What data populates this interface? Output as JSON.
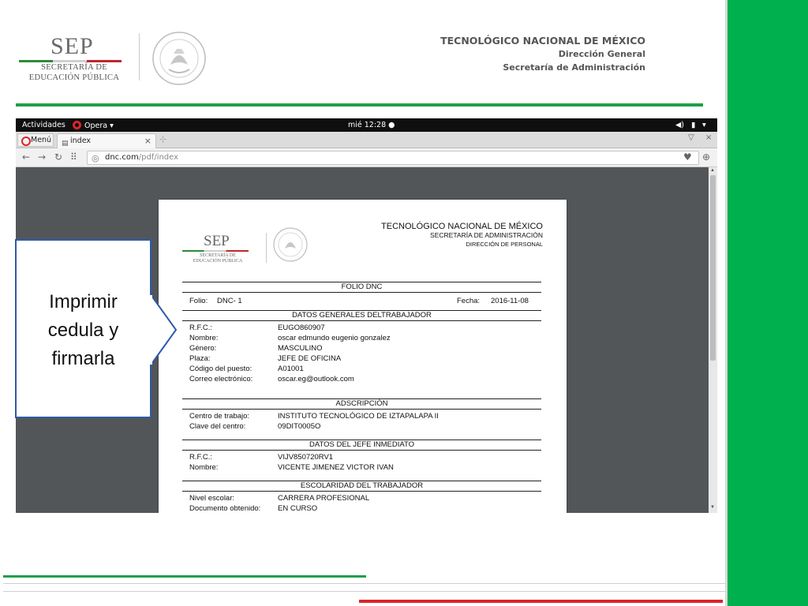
{
  "slide": {
    "sep_logo": {
      "word": "SEP",
      "line1": "SECRETARÍA DE",
      "line2": "EDUCACIÓN PÚBLICA"
    },
    "institution": {
      "title": "TECNOLÓGICO NACIONAL DE MÉXICO",
      "line2": "Dirección General",
      "line3": "Secretaría de Administración"
    },
    "callout_text": [
      "Imprimir",
      "cedula y",
      "firmarla"
    ]
  },
  "screenshot": {
    "gnome": {
      "activities": "Actividades",
      "app": "Opera ▾",
      "clock": "mié 12:28 ●"
    },
    "tabs": {
      "menu_label": "Menú",
      "active_tab": "index"
    },
    "address": {
      "domain": "dnc.com",
      "path": "/pdf/index"
    }
  },
  "pdf": {
    "sep_logo": {
      "word": "SEP",
      "line1": "SECRETARÍA DE",
      "line2": "EDUCACIÓN PÚBLICA"
    },
    "header": {
      "title": "TECNOLÓGICO NACIONAL DE MÉXICO",
      "sub1": "SECRETARÍA DE ADMINISTRACIÓN",
      "sub2": "DIRECCIÓN DE PERSONAL"
    },
    "folio_section": "FOLIO DNC",
    "folio_label": "Folio:",
    "folio_value": "DNC- 1",
    "fecha_label": "Fecha:",
    "fecha_value": "2016-11-08",
    "general_title": "DATOS GENERALES DELTRABAJADOR",
    "general": [
      {
        "label": "R.F.C.:",
        "value": "EUGO860907"
      },
      {
        "label": "Nombre:",
        "value": "oscar edmundo eugenio gonzalez"
      },
      {
        "label": "Género:",
        "value": "MASCULINO"
      },
      {
        "label": "Plaza:",
        "value": "JEFE DE OFICINA"
      },
      {
        "label": "Código del puesto:",
        "value": "A01001"
      },
      {
        "label": "Correo electrónico:",
        "value": "oscar.eg@outlook.com"
      }
    ],
    "adscripcion_title": "ADSCRIPCIÓN",
    "adscripcion": [
      {
        "label": "Centro de trabajo:",
        "value": "INSTITUTO TECNOLÓGICO DE IZTAPALAPA II"
      },
      {
        "label": "Clave del centro:",
        "value": "09DIT0005O"
      }
    ],
    "jefe_title": "DATOS DEL JEFE INMEDIATO",
    "jefe": [
      {
        "label": "R.F.C.:",
        "value": "VIJV850720RV1"
      },
      {
        "label": "Nombre:",
        "value": "VICENTE JIMENEZ VICTOR IVAN"
      }
    ],
    "escolaridad_title": "ESCOLARIDAD DEL TRABAJADOR",
    "escolaridad": [
      {
        "label": "Nivel escolar:",
        "value": "CARRERA PROFESIONAL"
      },
      {
        "label": "Documento obtenido:",
        "value": "EN CURSO"
      }
    ]
  },
  "colors": {
    "accent_green": "#00b04f",
    "line_green": "#1f9e4a",
    "accent_red": "#d8262b",
    "callout_border": "#2f5aa7"
  }
}
